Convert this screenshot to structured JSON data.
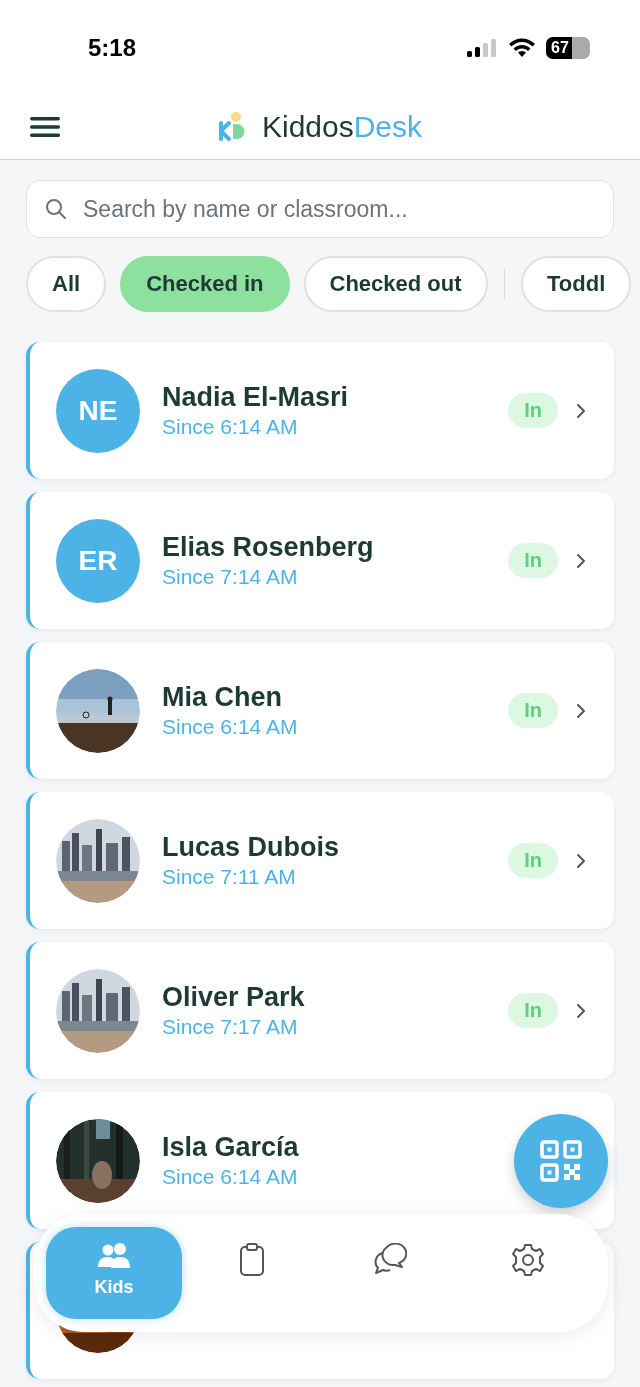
{
  "status_bar": {
    "time": "5:18",
    "battery": "67"
  },
  "header": {
    "brand_first": "Kiddos",
    "brand_second": "Desk"
  },
  "search": {
    "placeholder": "Search by name or classroom..."
  },
  "filters": [
    {
      "label": "All",
      "selected": false
    },
    {
      "label": "Checked in",
      "selected": true
    },
    {
      "label": "Checked out",
      "selected": false
    },
    {
      "label": "Toddl",
      "selected": false
    }
  ],
  "kids": [
    {
      "kind": "initials",
      "initials": "NE",
      "name": "Nadia El-Masri",
      "since": "Since 6:14 AM",
      "badge": "In"
    },
    {
      "kind": "initials",
      "initials": "ER",
      "name": "Elias Rosenberg",
      "since": "Since 7:14 AM",
      "badge": "In"
    },
    {
      "kind": "picture",
      "name": "Mia Chen",
      "since": "Since 6:14 AM",
      "badge": "In"
    },
    {
      "kind": "picture",
      "name": "Lucas Dubois",
      "since": "Since 7:11 AM",
      "badge": "In"
    },
    {
      "kind": "picture",
      "name": "Oliver Park",
      "since": "Since 7:17 AM",
      "badge": "In"
    },
    {
      "kind": "picture",
      "name": "Isla García",
      "since": "Since 6:14 AM"
    },
    {
      "kind": "picture"
    }
  ],
  "tabs": [
    {
      "label": "Kids",
      "selected": true
    },
    {
      "selected": false
    },
    {
      "selected": false
    },
    {
      "selected": false
    }
  ]
}
